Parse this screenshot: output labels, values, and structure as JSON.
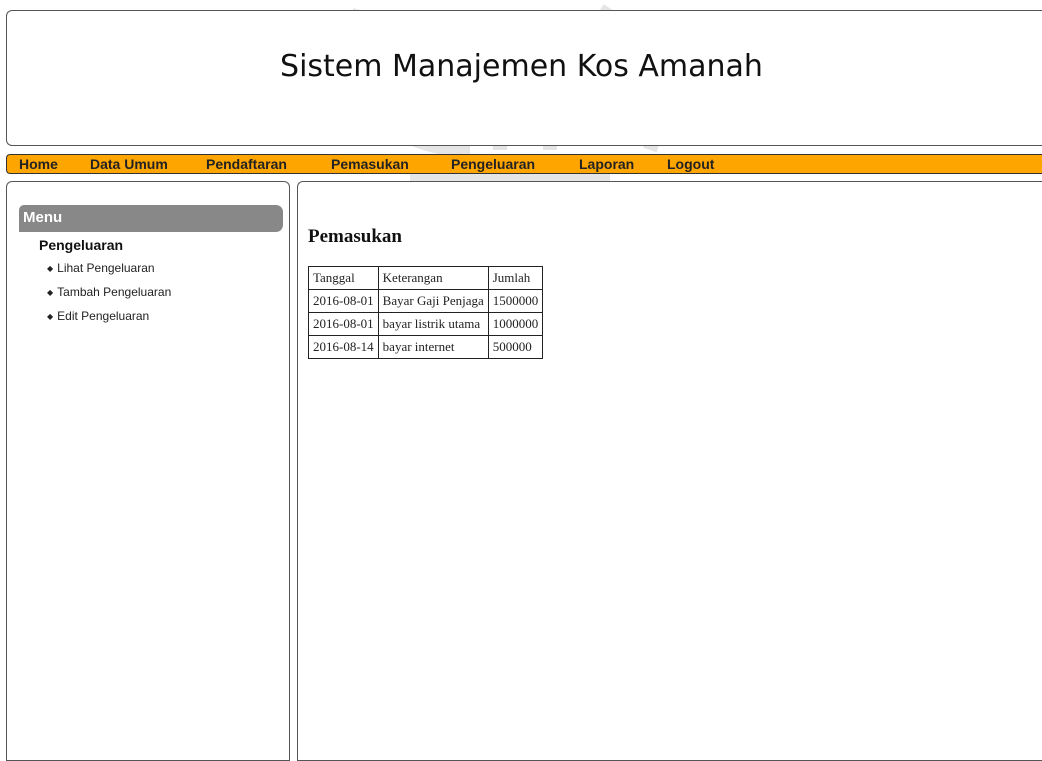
{
  "header": {
    "title": "Sistem Manajemen Kos Amanah"
  },
  "nav": {
    "items": [
      {
        "label": "Home"
      },
      {
        "label": "Data Umum"
      },
      {
        "label": "Pendaftaran"
      },
      {
        "label": "Pemasukan"
      },
      {
        "label": "Pengeluaran"
      },
      {
        "label": "Laporan"
      },
      {
        "label": "Logout"
      }
    ]
  },
  "sidebar": {
    "menu_title": "Menu",
    "section_title": "Pengeluaran",
    "items": [
      {
        "label": "Lihat Pengeluaran"
      },
      {
        "label": "Tambah Pengeluaran"
      },
      {
        "label": "Edit Pengeluaran"
      }
    ]
  },
  "content": {
    "title": "Pemasukan",
    "table": {
      "headers": [
        "Tanggal",
        "Keterangan",
        "Jumlah"
      ],
      "rows": [
        [
          "2016-08-01",
          "Bayar Gaji Penjaga",
          "1500000"
        ],
        [
          "2016-08-01",
          "bayar listrik utama",
          "1000000"
        ],
        [
          "2016-08-14",
          "bayar internet",
          "500000"
        ]
      ]
    }
  },
  "colors": {
    "nav_background": "#ffa500",
    "menu_header_background": "#888888"
  }
}
